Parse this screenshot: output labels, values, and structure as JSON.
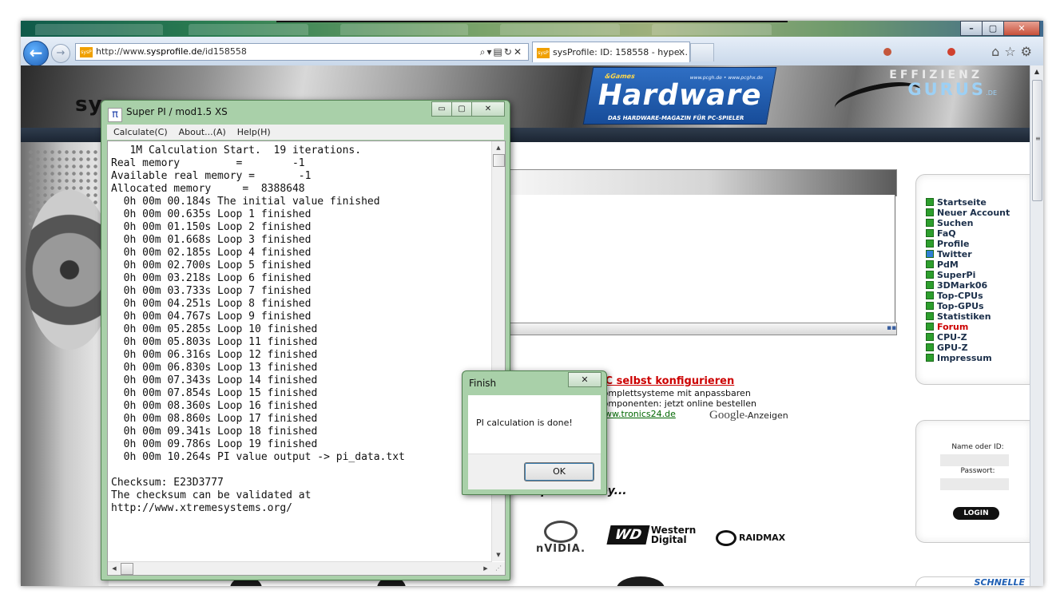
{
  "browser": {
    "url": "http://www.sysprofile.de/id158558",
    "url_prefix": "http://www.",
    "url_domain": "sysprofile.de",
    "url_path": "/id158558",
    "tab_title": "sysProfile: ID: 158558 - hype...",
    "favicon_text": "sysP",
    "window_controls": [
      "–",
      "▢",
      "✕"
    ]
  },
  "page": {
    "logo_partial": "sy",
    "header_logo_pcgames": "&Games",
    "header_logo_pcgh_url": "www.pcgh.de • www.pcghx.de",
    "header_logo_hardware": "Hardware",
    "header_logo_hardware_sub": "DAS HARDWARE-MAGAZIN FÜR PC-SPIELER",
    "header_logo_effizienz": "EFFIZIENZ",
    "header_logo_gurus": "GURUS",
    "header_logo_gurus_de": ".DE",
    "ad": {
      "title": "PC selbst konfigurieren",
      "line1": "Komplettsysteme mit anpassbaren",
      "line2": "Komponenten: jetzt online bestellen",
      "link": "www.tronics24.de",
      "google_word": "Google",
      "google_suffix": "-Anzeigen"
    },
    "powered_by": "...m is powered by...",
    "brands": {
      "nvidia": "nVIDIA.",
      "wd_box": "WD",
      "wd_line1": "Western",
      "wd_line2": "Digital",
      "raidmax": "RAIDMAX"
    },
    "menu": [
      {
        "label": "Startseite",
        "color": "#2d9e2d"
      },
      {
        "label": "Neuer Account",
        "color": "#2d9e2d"
      },
      {
        "label": "Suchen",
        "color": "#2d9e2d"
      },
      {
        "label": "FaQ",
        "color": "#2d9e2d"
      },
      {
        "label": "Profile",
        "color": "#2d9e2d"
      },
      {
        "label": "Twitter",
        "color": "#2f7fd4"
      },
      {
        "label": "PdM",
        "color": "#2d9e2d"
      },
      {
        "label": "SuperPi",
        "color": "#2d9e2d"
      },
      {
        "label": "3DMark06",
        "color": "#2d9e2d"
      },
      {
        "label": "Top-CPUs",
        "color": "#2d9e2d"
      },
      {
        "label": "Top-GPUs",
        "color": "#2d9e2d"
      },
      {
        "label": "Statistiken",
        "color": "#2d9e2d"
      },
      {
        "label": "Forum",
        "color": "#2d9e2d"
      },
      {
        "label": "CPU-Z",
        "color": "#2d9e2d"
      },
      {
        "label": "GPU-Z",
        "color": "#2d9e2d"
      },
      {
        "label": "Impressum",
        "color": "#2d9e2d"
      }
    ],
    "login": {
      "name_label": "Name oder ID:",
      "password_label": "Passwort:",
      "button": "LOGIN"
    },
    "schnelle": "SCHNELLE"
  },
  "superpi": {
    "title": "Super PI / mod1.5 XS",
    "icon_glyph": "π",
    "controls": [
      "▭",
      "▢",
      "✕"
    ],
    "menu": [
      "Calculate(C)",
      "About...(A)",
      "Help(H)"
    ],
    "output_lines": [
      "   1M Calculation Start.  19 iterations.",
      "Real memory         =        -1",
      "Available real memory =       -1",
      "Allocated memory     =  8388648",
      "  0h 00m 00.184s The initial value finished",
      "  0h 00m 00.635s Loop 1 finished",
      "  0h 00m 01.150s Loop 2 finished",
      "  0h 00m 01.668s Loop 3 finished",
      "  0h 00m 02.185s Loop 4 finished",
      "  0h 00m 02.700s Loop 5 finished",
      "  0h 00m 03.218s Loop 6 finished",
      "  0h 00m 03.733s Loop 7 finished",
      "  0h 00m 04.251s Loop 8 finished",
      "  0h 00m 04.767s Loop 9 finished",
      "  0h 00m 05.285s Loop 10 finished",
      "  0h 00m 05.803s Loop 11 finished",
      "  0h 00m 06.316s Loop 12 finished",
      "  0h 00m 06.830s Loop 13 finished",
      "  0h 00m 07.343s Loop 14 finished",
      "  0h 00m 07.854s Loop 15 finished",
      "  0h 00m 08.360s Loop 16 finished",
      "  0h 00m 08.860s Loop 17 finished",
      "  0h 00m 09.341s Loop 18 finished",
      "  0h 00m 09.786s Loop 19 finished",
      "  0h 00m 10.264s PI value output -> pi_data.txt",
      "",
      "Checksum: E23D3777",
      "The checksum can be validated at",
      "http://www.xtremesystems.org/"
    ]
  },
  "finish_dialog": {
    "title": "Finish",
    "close": "✕",
    "message": "PI calculation is done!",
    "ok": "OK"
  },
  "colors": {
    "window_frame": "#a9d0a9",
    "link_red": "#cc0000",
    "link_green": "#006600",
    "menu_bullet_green": "#2d9e2d",
    "menu_bullet_blue": "#2f7fd4"
  }
}
